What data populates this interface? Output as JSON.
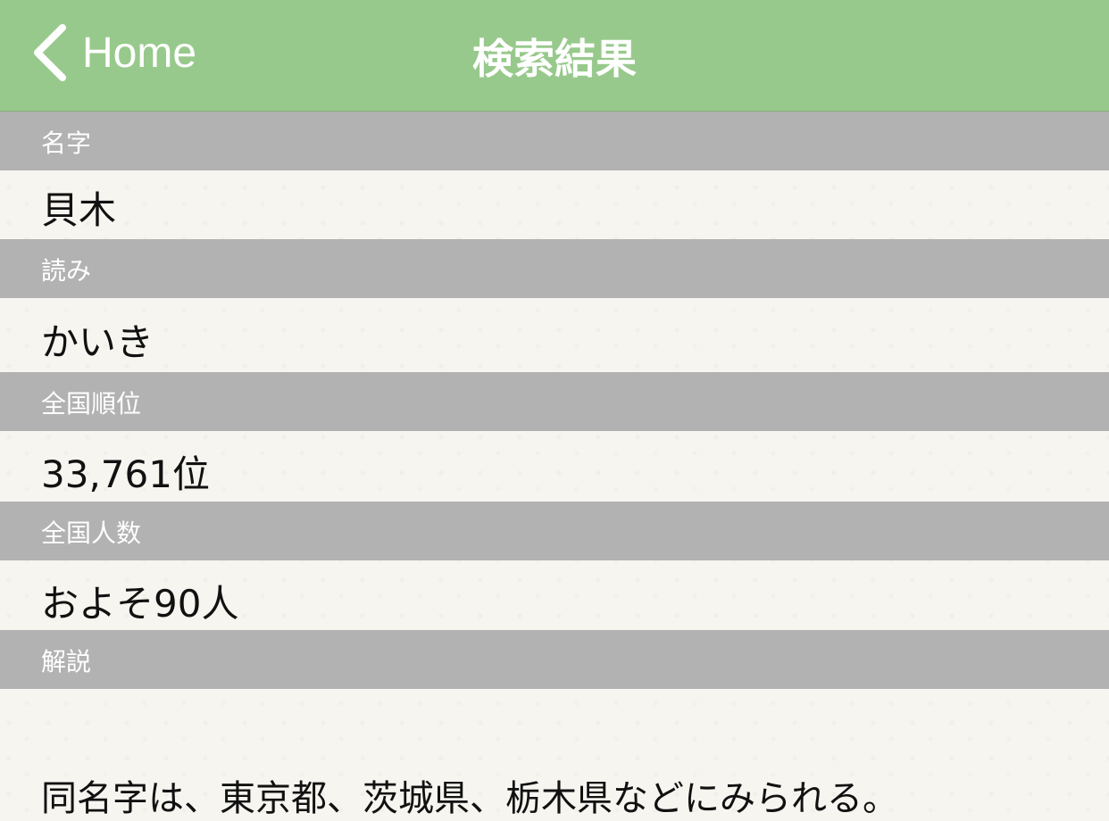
{
  "navbar": {
    "back_label": "Home",
    "title": "検索結果"
  },
  "fields": {
    "surname": {
      "label": "名字",
      "value": "貝木"
    },
    "reading": {
      "label": "読み",
      "value": "かいき"
    },
    "rank": {
      "label": "全国順位",
      "value": "33,761位"
    },
    "population": {
      "label": "全国人数",
      "value": "およそ90人"
    },
    "description": {
      "label": "解説",
      "value": "同名字は、東京都、茨城県、栃木県などにみられる。"
    }
  },
  "colors": {
    "navbar": "#98c98c",
    "section_header": "#b2b2b2",
    "background": "#f6f5f0"
  },
  "icons": {
    "back": "chevron-left-icon"
  }
}
